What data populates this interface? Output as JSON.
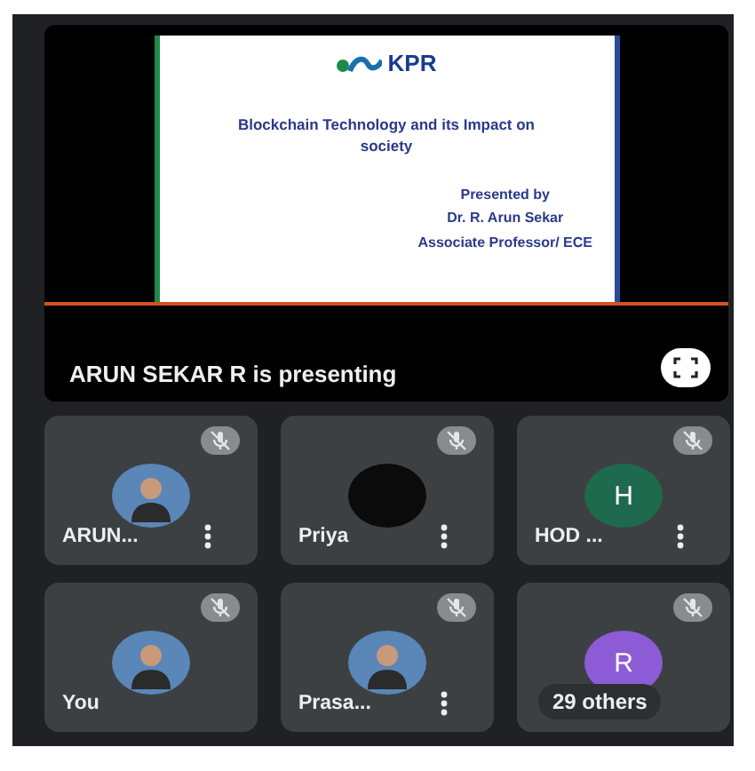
{
  "presentation": {
    "slide": {
      "logo": "KPR",
      "title": "Blockchain Technology and its Impact on society",
      "presenter_lines": [
        "Presented by",
        "Dr. R. Arun Sekar",
        "Associate Professor/ ECE"
      ]
    },
    "caption": "ARUN SEKAR R is presenting"
  },
  "participants": [
    {
      "name": "ARUN...",
      "muted": true,
      "menu": true
    },
    {
      "name": "Priya",
      "kind": "dark",
      "muted": true,
      "menu": true
    },
    {
      "name": "HOD ...",
      "kind": "initial",
      "initial": "H",
      "color": "#1e6a4f",
      "muted": true,
      "menu": true
    },
    {
      "name": "You",
      "muted": true,
      "menu": false
    },
    {
      "name": "Prasa...",
      "muted": true,
      "menu": true
    },
    {
      "kind": "initial",
      "initial": "R",
      "color": "#8e5bd6",
      "muted": true,
      "menu": false,
      "overflow": "29 others"
    }
  ]
}
